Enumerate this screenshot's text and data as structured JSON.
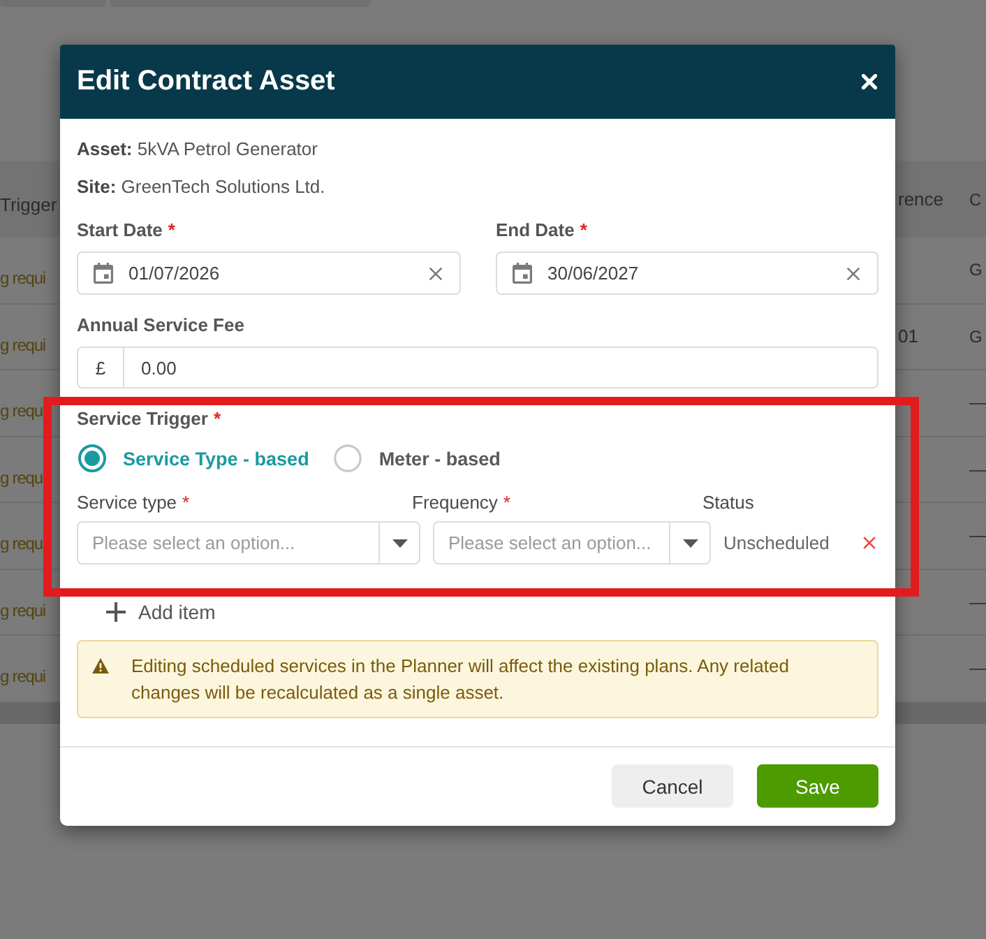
{
  "background": {
    "table": {
      "columns": [
        "Trigger",
        "rence",
        "C"
      ],
      "rows": [
        {
          "trigger": "g requi",
          "column_3": "G"
        },
        {
          "trigger": "g requi",
          "column_2": "01",
          "column_3": "G"
        },
        {
          "trigger": "g requ",
          "column_3": "—"
        },
        {
          "trigger": "g requ",
          "column_3": "—"
        },
        {
          "trigger": "g requ",
          "column_3": "—"
        },
        {
          "trigger": "g requi",
          "column_3": "—"
        },
        {
          "trigger": "g requi",
          "column_3": "—"
        }
      ]
    }
  },
  "dialog": {
    "title": "Edit Contract Asset",
    "details": [
      "**Asset:** 5kVA Petrol Generator",
      "**Site:** GreenTech Solutions Ltd."
    ],
    "date_fields": [
      {
        "label": "Start Date",
        "required_mark": "*",
        "value": "01/07/2026"
      },
      {
        "label": "End Date",
        "required_mark": "*",
        "value": "30/06/2027"
      }
    ],
    "fee": {
      "label": "Annual Service Fee",
      "currency": "£",
      "value": "0.00"
    },
    "service_trigger": {
      "label": "Service Trigger",
      "required_mark": "*",
      "options": [
        {
          "label": "Service Type - based",
          "selected": true
        },
        {
          "label": "Meter - based",
          "selected": false
        }
      ]
    },
    "service_items": {
      "columns": [
        {
          "label": "Service type",
          "required_mark": "*"
        },
        {
          "label": "Frequency",
          "required_mark": "*"
        },
        {
          "label": "Status"
        }
      ],
      "rows": [
        {
          "service_type_placeholder": "Please select an option...",
          "frequency_placeholder": "Please select an option...",
          "status": "Unscheduled"
        }
      ]
    },
    "add_item": "Add item",
    "warning": "Editing scheduled services in the Planner will affect the existing plans. Any related changes will be recalculated as a single asset.",
    "buttons": [
      {
        "label": "Cancel",
        "kind": "secondary"
      },
      {
        "label": "Save",
        "kind": "primary"
      }
    ]
  }
}
